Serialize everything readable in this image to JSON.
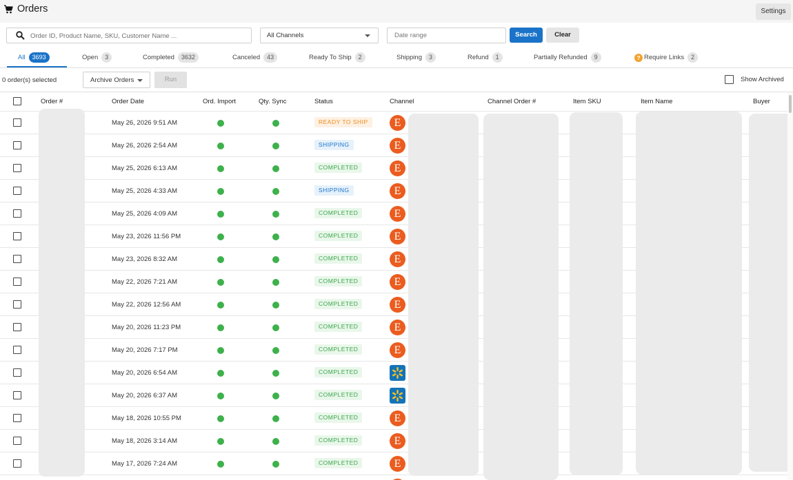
{
  "header": {
    "title": "Orders",
    "settings_label": "Settings"
  },
  "filters": {
    "search_placeholder": "Order ID, Product Name, SKU, Customer Name ...",
    "channel_selected": "All Channels",
    "date_placeholder": "Date range",
    "search_label": "Search",
    "clear_label": "Clear"
  },
  "tabs": [
    {
      "label": "All",
      "count": "3693"
    },
    {
      "label": "Open",
      "count": "3"
    },
    {
      "label": "Completed",
      "count": "3632"
    },
    {
      "label": "Canceled",
      "count": "43"
    },
    {
      "label": "Ready To Ship",
      "count": "2"
    },
    {
      "label": "Shipping",
      "count": "3"
    },
    {
      "label": "Refund",
      "count": "1"
    },
    {
      "label": "Partially Refunded",
      "count": "9"
    },
    {
      "label": "Require Links",
      "count": "2"
    }
  ],
  "actions": {
    "selected_text": "0 order(s) selected",
    "archive_selected": "Archive Orders",
    "run_label": "Run",
    "show_archived_label": "Show Archived"
  },
  "columns": [
    "Order #",
    "Order Date",
    "Ord. Import",
    "Qty. Sync",
    "Status",
    "Channel",
    "Channel Order #",
    "Item SKU",
    "Item Name",
    "Buyer"
  ],
  "rows": [
    {
      "date": "May 26, 2026 9:51 AM",
      "status": "READY TO SHIP",
      "status_kind": "ready",
      "channel": "etsy"
    },
    {
      "date": "May 26, 2026 2:54 AM",
      "status": "SHIPPING",
      "status_kind": "shipping",
      "channel": "etsy"
    },
    {
      "date": "May 25, 2026 6:13 AM",
      "status": "COMPLETED",
      "status_kind": "completed",
      "channel": "etsy"
    },
    {
      "date": "May 25, 2026 4:33 AM",
      "status": "SHIPPING",
      "status_kind": "shipping",
      "channel": "etsy"
    },
    {
      "date": "May 25, 2026 4:09 AM",
      "status": "COMPLETED",
      "status_kind": "completed",
      "channel": "etsy"
    },
    {
      "date": "May 23, 2026 11:56 PM",
      "status": "COMPLETED",
      "status_kind": "completed",
      "channel": "etsy"
    },
    {
      "date": "May 23, 2026 8:32 AM",
      "status": "COMPLETED",
      "status_kind": "completed",
      "channel": "etsy"
    },
    {
      "date": "May 22, 2026 7:21 AM",
      "status": "COMPLETED",
      "status_kind": "completed",
      "channel": "etsy"
    },
    {
      "date": "May 22, 2026 12:56 AM",
      "status": "COMPLETED",
      "status_kind": "completed",
      "channel": "etsy"
    },
    {
      "date": "May 20, 2026 11:23 PM",
      "status": "COMPLETED",
      "status_kind": "completed",
      "channel": "etsy"
    },
    {
      "date": "May 20, 2026 7:17 PM",
      "status": "COMPLETED",
      "status_kind": "completed",
      "channel": "etsy"
    },
    {
      "date": "May 20, 2026 6:54 AM",
      "status": "COMPLETED",
      "status_kind": "completed",
      "channel": "walmart"
    },
    {
      "date": "May 20, 2026 6:37 AM",
      "status": "COMPLETED",
      "status_kind": "completed",
      "channel": "walmart"
    },
    {
      "date": "May 18, 2026 10:55 PM",
      "status": "COMPLETED",
      "status_kind": "completed",
      "channel": "etsy"
    },
    {
      "date": "May 18, 2026 3:14 AM",
      "status": "COMPLETED",
      "status_kind": "completed",
      "channel": "etsy"
    },
    {
      "date": "May 17, 2026 7:24 AM",
      "status": "COMPLETED",
      "status_kind": "completed",
      "channel": "etsy"
    }
  ],
  "channel_icons": {
    "etsy": "E",
    "walmart": "walmart-spark-icon"
  },
  "colors": {
    "accent": "#1a73c8",
    "ready": "#f08a1c",
    "completed": "#3aa54a",
    "etsy": "#eb5c1f",
    "walmart": "#1473b8",
    "walmart_spark": "#ffc220",
    "ok_dot": "#3db14b"
  }
}
